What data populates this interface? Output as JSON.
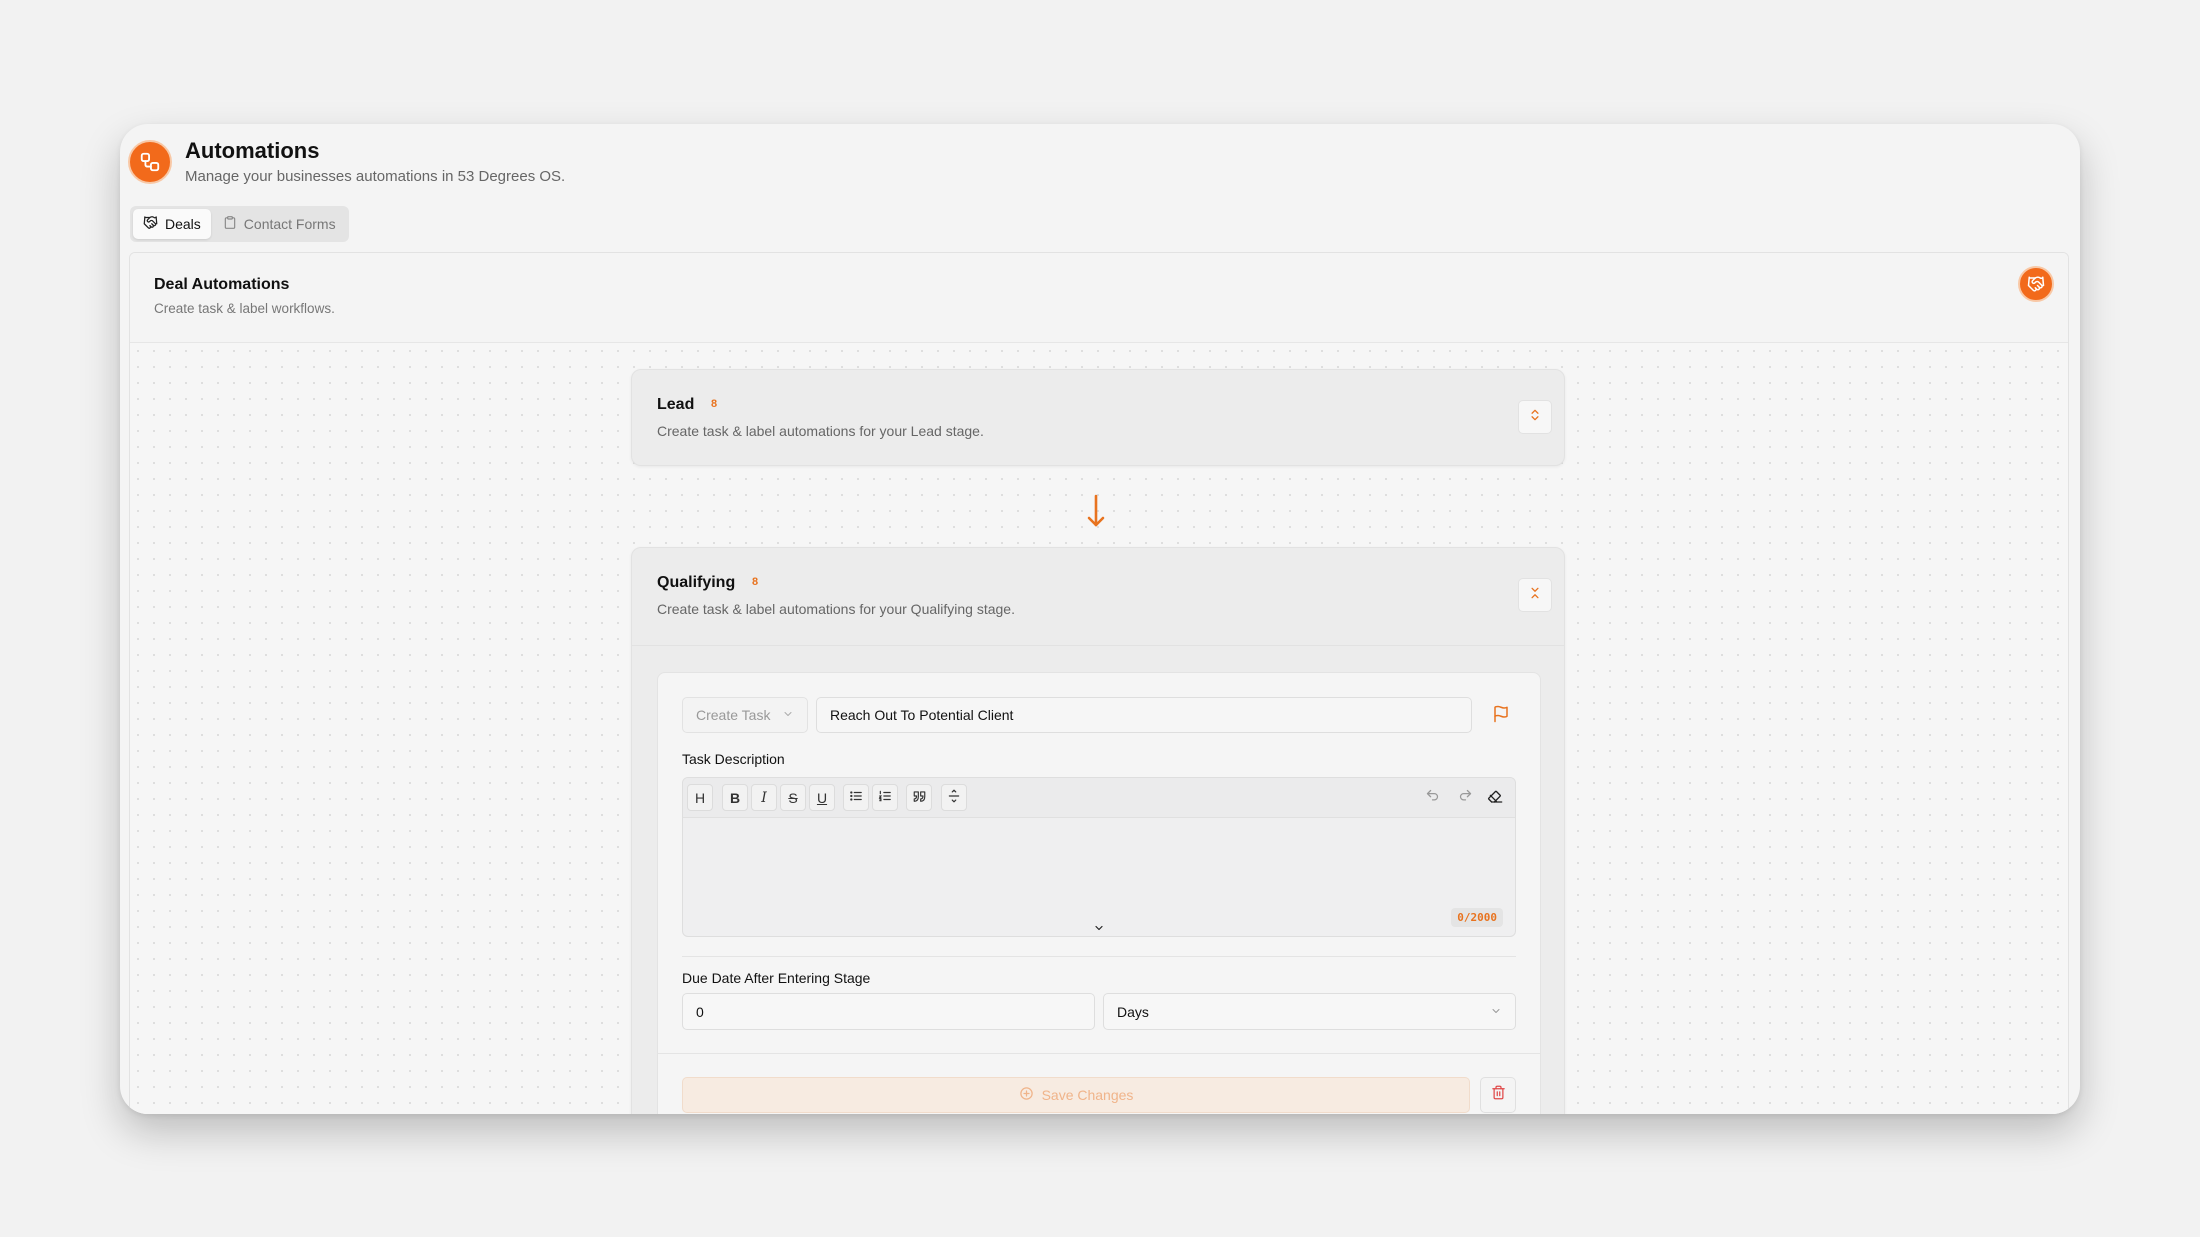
{
  "app": {
    "title": "Automations",
    "subtitle": "Manage your businesses automations in 53 Degrees OS.",
    "accent_color": "#f26a1b"
  },
  "tabs": [
    {
      "label": "Deals",
      "icon": "handshake-icon",
      "active": true
    },
    {
      "label": "Contact Forms",
      "icon": "clipboard-icon",
      "active": false
    }
  ],
  "panel": {
    "title": "Deal Automations",
    "subtitle": "Create task & label workflows.",
    "badge_icon": "handshake-icon"
  },
  "stages": [
    {
      "name": "Lead",
      "count": "8",
      "description": "Create task & label automations for your Lead stage.",
      "expanded": false
    },
    {
      "name": "Qualifying",
      "count": "8",
      "description": "Create task & label automations for your Qualifying stage.",
      "expanded": true
    }
  ],
  "task": {
    "action_select": "Create Task",
    "title_value": "Reach Out To Potential Client",
    "description_label": "Task Description",
    "toolbar": [
      "heading",
      "bold",
      "italic",
      "strikethrough",
      "underline",
      "bullet-list",
      "ordered-list",
      "quote",
      "horizontal-rule",
      "undo",
      "redo",
      "clear-format"
    ],
    "heading_glyph": "H",
    "bold_glyph": "B",
    "italic_glyph": "I",
    "strike_glyph": "S",
    "underline_glyph": "U",
    "char_count": "0/2000",
    "due_label": "Due Date After Entering Stage",
    "due_value": "0",
    "due_unit": "Days",
    "save_label": "Save Changes"
  }
}
